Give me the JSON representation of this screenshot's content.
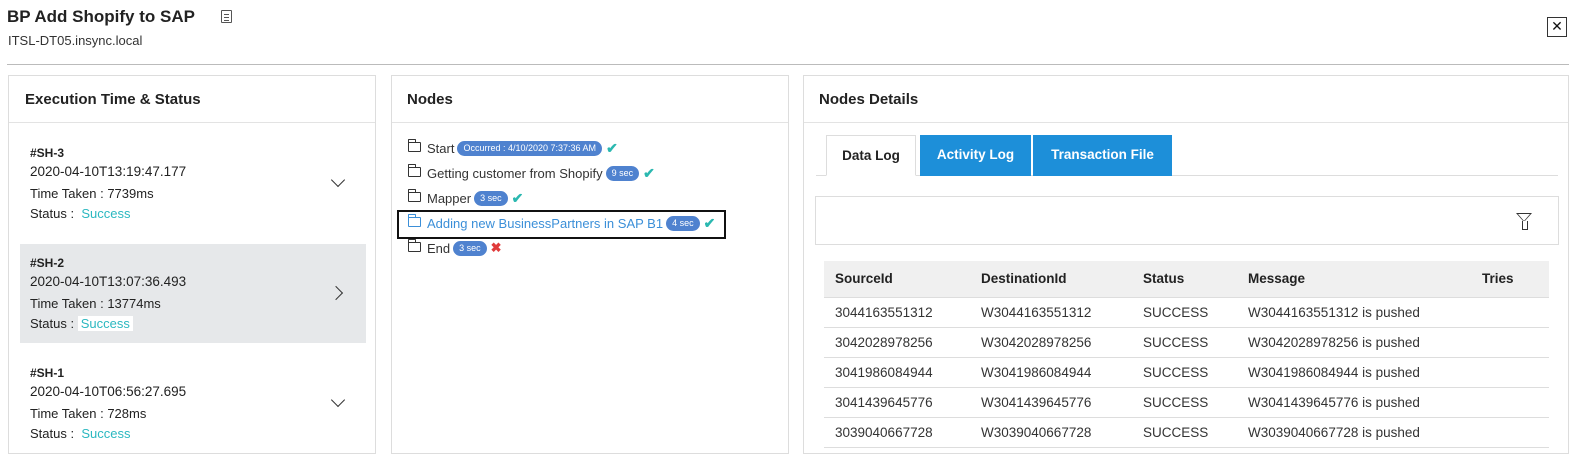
{
  "header": {
    "title": "BP Add Shopify to SAP",
    "subtitle": "ITSL-DT05.insync.local",
    "close_label": "✕"
  },
  "executions": {
    "title": "Execution Time & Status",
    "time_taken_label": "Time Taken :",
    "status_label": "Status :",
    "items": [
      {
        "id": "#SH-3",
        "datetime": "2020-04-10T13:19:47.177",
        "time_taken": "7739ms",
        "status": "Success",
        "expanded": false
      },
      {
        "id": "#SH-2",
        "datetime": "2020-04-10T13:07:36.493",
        "time_taken": "13774ms",
        "status": "Success",
        "selected": true
      },
      {
        "id": "#SH-1",
        "datetime": "2020-04-10T06:56:27.695",
        "time_taken": "728ms",
        "status": "Success",
        "expanded": false
      }
    ]
  },
  "nodes": {
    "title": "Nodes",
    "items": [
      {
        "label": "Start",
        "badge": "Occurred : 4/10/2020 7:37:36 AM",
        "result": "success"
      },
      {
        "label": "Getting customer from Shopify",
        "badge": "9 sec",
        "result": "success"
      },
      {
        "label": "Mapper",
        "badge": "3 sec",
        "result": "success"
      },
      {
        "label": "Adding new BusinessPartners in SAP B1",
        "badge": "4 sec",
        "result": "success",
        "selected": true
      },
      {
        "label": "End",
        "badge": "3 sec",
        "result": "failure"
      }
    ]
  },
  "details": {
    "title": "Nodes Details",
    "tabs": [
      "Data Log",
      "Activity Log",
      "Transaction File"
    ],
    "active_tab": "Data Log",
    "columns": [
      "SourceId",
      "DestinationId",
      "Status",
      "Message",
      "Tries"
    ],
    "rows": [
      [
        "3044163551312",
        "W3044163551312",
        "SUCCESS",
        "W3044163551312 is pushed",
        ""
      ],
      [
        "3042028978256",
        "W3042028978256",
        "SUCCESS",
        "W3042028978256 is pushed",
        ""
      ],
      [
        "3041986084944",
        "W3041986084944",
        "SUCCESS",
        "W3041986084944 is pushed",
        ""
      ],
      [
        "3041439645776",
        "W3041439645776",
        "SUCCESS",
        "W3041439645776 is pushed",
        ""
      ],
      [
        "3039040667728",
        "W3039040667728",
        "SUCCESS",
        "W3039040667728 is pushed",
        ""
      ]
    ]
  },
  "colors": {
    "accent": "#1d8fd9",
    "success": "#2bb8c0",
    "failure": "#e03a3a",
    "badge": "#4f82cf",
    "selected_row": "#e6e8ea"
  }
}
